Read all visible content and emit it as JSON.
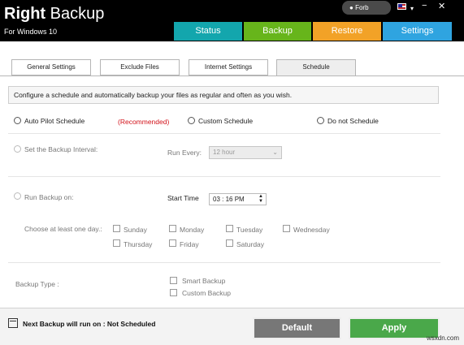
{
  "app": {
    "title_bold": "Right",
    "title_rest": " Backup",
    "subtitle": "For Windows 10",
    "user": "Forb",
    "caret": "▾",
    "minimize": "−",
    "close": "✕"
  },
  "nav_tabs": [
    "Status",
    "Backup",
    "Restore",
    "Settings"
  ],
  "settings_tabs": [
    "General Settings",
    "Exclude Files",
    "Internet Settings",
    "Schedule"
  ],
  "schedule": {
    "description": "Configure a schedule and automatically backup your files as regular and often as you wish.",
    "options": {
      "auto_pilot": "Auto Pilot Schedule",
      "recommended": "(Recommended)",
      "custom": "Custom Schedule",
      "none": "Do not Schedule"
    },
    "interval": {
      "label": "Set the Backup Interval:",
      "run_every_label": "Run Every:",
      "run_every_value": "12 hour"
    },
    "run_on": {
      "label": "Run Backup on:",
      "start_time_label": "Start Time",
      "start_time_value": "03 : 16 PM",
      "days_label": "Choose at least one day.:",
      "days": [
        "Sunday",
        "Monday",
        "Tuesday",
        "Wednesday",
        "Thursday",
        "Friday",
        "Saturday"
      ]
    },
    "backup_type": {
      "label": "Backup Type :",
      "options": [
        "Smart Backup",
        "Custom Backup"
      ]
    }
  },
  "footer": {
    "next_backup": "Next Backup will run on : Not Scheduled",
    "default_button": "Default",
    "apply_button": "Apply"
  },
  "watermark": "wsxdn.com",
  "colors": {
    "status": "#13a6ad",
    "backup": "#67b51b",
    "restore": "#f2a227",
    "settings": "#2fa4e0",
    "recommended": "#d2121a",
    "default_button": "#777777",
    "apply_button": "#4aa84a"
  }
}
